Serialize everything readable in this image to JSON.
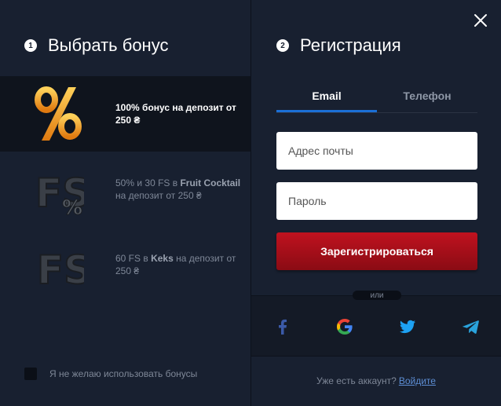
{
  "left": {
    "step_num": "1",
    "title": "Выбрать бонус",
    "bonuses": [
      {
        "text": "100% бонус на депозит от 250 ₴",
        "icon": "percent-bonus-icon"
      },
      {
        "pre": "50% и 30 FS в ",
        "game": "Fruit Cocktail",
        "post": " на депозит от 250 ₴",
        "icon": "fs-percent-bonus-icon"
      },
      {
        "pre": "60 FS в ",
        "game": "Keks",
        "post": " на депозит от 250 ₴",
        "icon": "fs-bonus-icon"
      }
    ],
    "no_bonus_label": "Я не желаю использовать бонусы"
  },
  "right": {
    "step_num": "2",
    "title": "Регистрация",
    "tabs": [
      "Email",
      "Телефон"
    ],
    "email_placeholder": "Адрес почты",
    "password_placeholder": "Пароль",
    "register_label": "Зарегистрироваться",
    "or_label": "или",
    "social": [
      "facebook-icon",
      "google-icon",
      "twitter-icon",
      "telegram-icon"
    ],
    "login_prompt": "Уже есть аккаунт?",
    "login_link": "Войдите"
  },
  "colors": {
    "accent_blue": "#1b6fd6",
    "register_red": "#c0121f",
    "panel_bg": "#182030",
    "active_bonus_bg": "#0f141d"
  }
}
